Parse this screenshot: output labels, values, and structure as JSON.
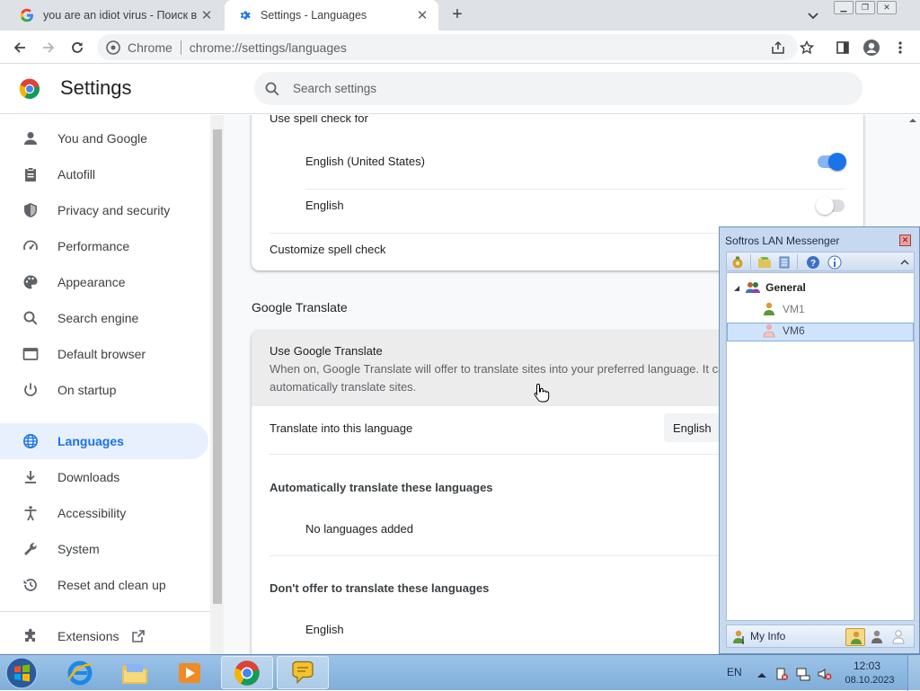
{
  "browser": {
    "tabs": [
      {
        "title": "you are an idiot virus - Поиск в Go",
        "close": "✕"
      },
      {
        "title": "Settings - Languages",
        "close": "✕"
      }
    ],
    "new_tab": "+",
    "omnibox": {
      "site": "Chrome",
      "url": "chrome://settings/languages"
    },
    "window_controls": [
      "▁",
      "❐",
      "✕"
    ]
  },
  "header": {
    "title": "Settings",
    "search_placeholder": "Search settings"
  },
  "sidebar": {
    "items": [
      {
        "label": "You and Google",
        "icon": "person-icon"
      },
      {
        "label": "Autofill",
        "icon": "clipboard-icon"
      },
      {
        "label": "Privacy and security",
        "icon": "shield-icon"
      },
      {
        "label": "Performance",
        "icon": "speedometer-icon"
      },
      {
        "label": "Appearance",
        "icon": "palette-icon"
      },
      {
        "label": "Search engine",
        "icon": "search-icon"
      },
      {
        "label": "Default browser",
        "icon": "browser-window-icon"
      },
      {
        "label": "On startup",
        "icon": "power-icon"
      },
      {
        "label": "Languages",
        "icon": "globe-icon",
        "active": true
      },
      {
        "label": "Downloads",
        "icon": "download-icon"
      },
      {
        "label": "Accessibility",
        "icon": "accessibility-icon"
      },
      {
        "label": "System",
        "icon": "wrench-icon"
      },
      {
        "label": "Reset and clean up",
        "icon": "history-icon"
      }
    ],
    "extensions_label": "Extensions"
  },
  "spellcheck": {
    "heading": "Use spell check for",
    "languages": [
      {
        "label": "English (United States)",
        "enabled": true
      },
      {
        "label": "English",
        "enabled": false
      }
    ],
    "customize_label": "Customize spell check"
  },
  "translate": {
    "section_title": "Google Translate",
    "use_title": "Use Google Translate",
    "use_desc_1": "When on, Google Translate will offer to translate sites into your preferred language. It ca",
    "use_desc_2": "automatically translate sites.",
    "target_label": "Translate into this language",
    "target_value": "English",
    "auto_heading": "Automatically translate these languages",
    "auto_empty": "No languages added",
    "never_heading": "Don't offer to translate these languages",
    "never_items": [
      "English"
    ]
  },
  "messenger": {
    "title": "Softros LAN Messenger",
    "close": "✕",
    "group": "General",
    "users": [
      "VM1",
      "VM6"
    ],
    "selected_user": "VM6",
    "my_info": "My Info"
  },
  "taskbar": {
    "language": "EN",
    "time": "12:03",
    "date": "08.10.2023"
  },
  "colors": {
    "accent": "#1a73e8",
    "active_bg": "#e8f0fe",
    "toggle_on_track": "#8ab4f8",
    "toggle_off_track": "#dadce0"
  }
}
